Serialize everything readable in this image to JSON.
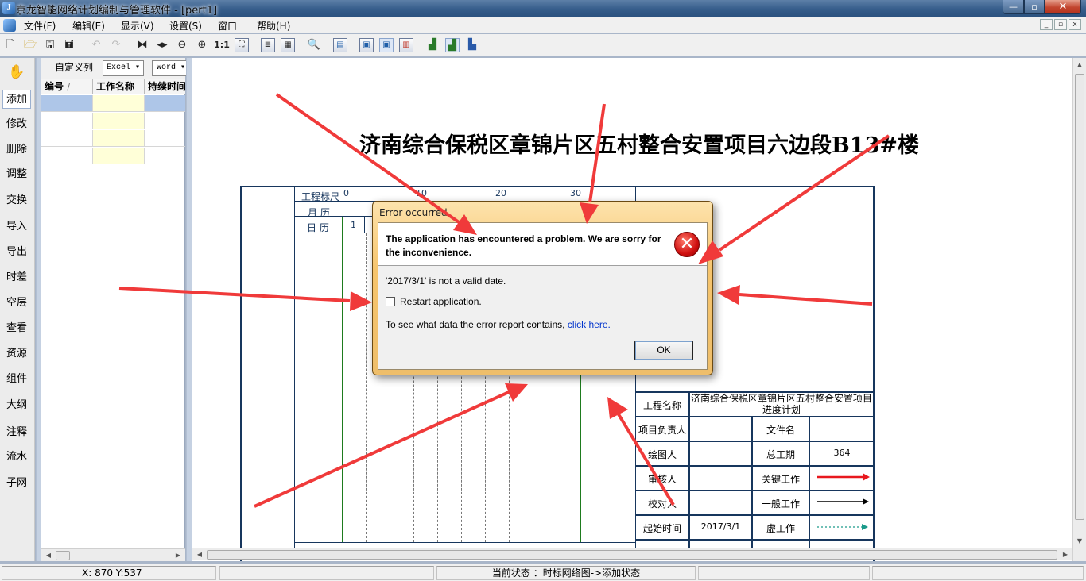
{
  "window": {
    "title": "京龙智能网络计划编制与管理软件 - [pert1]",
    "controls": {
      "minimize": "—",
      "maximize": "▫",
      "close": "✕"
    }
  },
  "menubar": {
    "items": [
      "文件(F)",
      "编辑(E)",
      "显示(V)",
      "设置(S)",
      "窗口",
      "帮助(H)"
    ]
  },
  "toolbar": {
    "zoom_actual_label": "1:1"
  },
  "left_tools": {
    "items": [
      "添加",
      "修改",
      "删除",
      "调整",
      "交换",
      "导入",
      "导出",
      "时差",
      "空层",
      "查看",
      "资源",
      "组件",
      "大纲",
      "注释",
      "流水",
      "子网"
    ],
    "active": "添加"
  },
  "task_panel": {
    "custom_columns_label": "自定义列",
    "excel_label": "Excel",
    "word_label": "Word",
    "columns": [
      "编号",
      "工作名称",
      "持续时间"
    ],
    "sort_indicator": "/"
  },
  "drawing": {
    "title": "济南综合保税区章锦片区五村整合安置项目六边段B13#楼",
    "timeline_labels": {
      "project_scale": "工程标尺",
      "month": "月 历",
      "day": "日 历"
    },
    "scale_ticks": [
      "0",
      "10",
      "20",
      "30"
    ],
    "day_first": "1",
    "info_table": {
      "project_name_label": "工程名称",
      "project_name_value": "济南综合保税区章锦片区五村整合安置项目进度计划",
      "manager_label": "项目负责人",
      "file_name_label": "文件名",
      "drawer_label": "绘图人",
      "total_duration_label": "总工期",
      "total_duration_value": "364",
      "reviewer_label": "审核人",
      "critical_work_label": "关键工作",
      "checker_label": "校对人",
      "normal_work_label": "一般工作",
      "start_time_label": "起始时间",
      "start_time_value": "2017/3/1",
      "virtual_work_label": "虚工作"
    },
    "colors": {
      "critical": "#e8181e",
      "normal": "#000000",
      "virtual": "#1a9a8a",
      "frame": "#17365d"
    }
  },
  "statusbar": {
    "coords": "X: 870   Y:537",
    "state": "当前状态 ：时标网络图->添加状态"
  },
  "error_dialog": {
    "title": "Error occurred",
    "heading": "The application has encountered a problem. We are sorry for the inconvenience.",
    "detail": "'2017/3/1' is not a valid date.",
    "restart_label": "Restart application.",
    "restart_checked": false,
    "report_text": "To see what data the error report contains,",
    "report_link": "click here.",
    "ok_label": "OK"
  }
}
